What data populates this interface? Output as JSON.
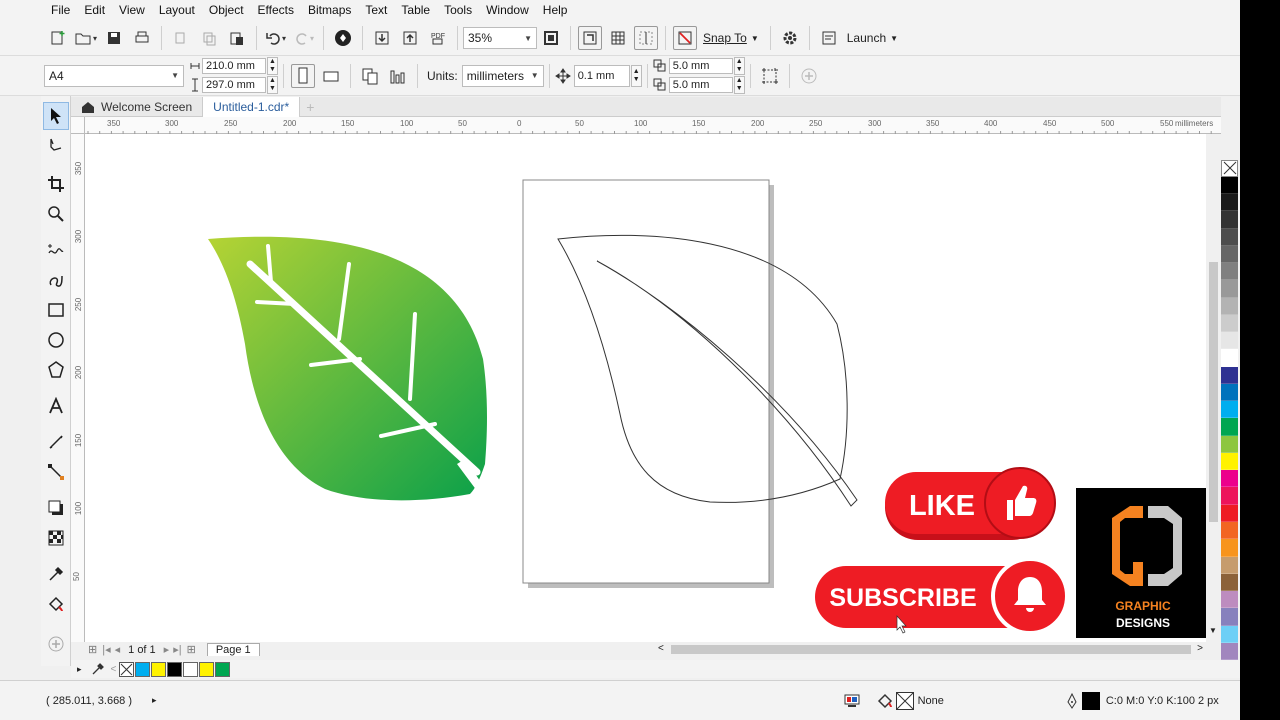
{
  "menu": [
    "File",
    "Edit",
    "View",
    "Layout",
    "Object",
    "Effects",
    "Bitmaps",
    "Text",
    "Table",
    "Tools",
    "Window",
    "Help"
  ],
  "toolbar": {
    "zoom": "35%",
    "snap_to": "Snap To",
    "launch": "Launch"
  },
  "property_bar": {
    "page_size": "A4",
    "width": "210.0 mm",
    "height": "297.0 mm",
    "units_label": "Units:",
    "units_value": "millimeters",
    "nudge": "0.1 mm",
    "dup_x": "5.0 mm",
    "dup_y": "5.0 mm"
  },
  "tabs": [
    "Welcome Screen",
    "Untitled-1.cdr*"
  ],
  "ruler": {
    "h_ticks": [
      "350",
      "300",
      "250",
      "200",
      "150",
      "100",
      "50",
      "0",
      "50",
      "100",
      "150",
      "200",
      "250",
      "300",
      "350",
      "400",
      "450",
      "500",
      "550"
    ],
    "h_unit": "millimeters",
    "v_ticks": [
      "350",
      "300",
      "250",
      "200",
      "150",
      "100",
      "50"
    ]
  },
  "overlay": {
    "like": "LIKE",
    "subscribe": "SUBSCRIBE",
    "logo_line1": "GRAPHIC",
    "logo_line2": "DESIGNS"
  },
  "pagebar": {
    "page_counter": "1 of 1",
    "page_tab": "Page 1"
  },
  "status": {
    "coords": "( 285.011, 3.668 )",
    "fill": "None",
    "outline": "C:0 M:0 Y:0 K:100  2 px"
  },
  "colors": {
    "leaf_light": "#b5d334",
    "leaf_dark": "#0aa04a",
    "red": "#ee1c24",
    "orange": "#f58220"
  },
  "palette": [
    "#000000",
    "#1a1a1a",
    "#333333",
    "#4d4d4d",
    "#666666",
    "#808080",
    "#999999",
    "#b3b3b3",
    "#cccccc",
    "#e6e6e6",
    "#ffffff",
    "#2e3192",
    "#0072bc",
    "#00aeef",
    "#00a651",
    "#8dc63f",
    "#fff200",
    "#ec008c",
    "#ed145b",
    "#ee1c24",
    "#f26522",
    "#f7941d",
    "#c69c6d",
    "#8c6239",
    "#bd8cbf",
    "#8781bd",
    "#6dcff6",
    "#a186be"
  ],
  "doc_palette": [
    "#00aeef",
    "#fff200",
    "#000000",
    "#ffffff",
    "#fff200",
    "#00a651"
  ]
}
